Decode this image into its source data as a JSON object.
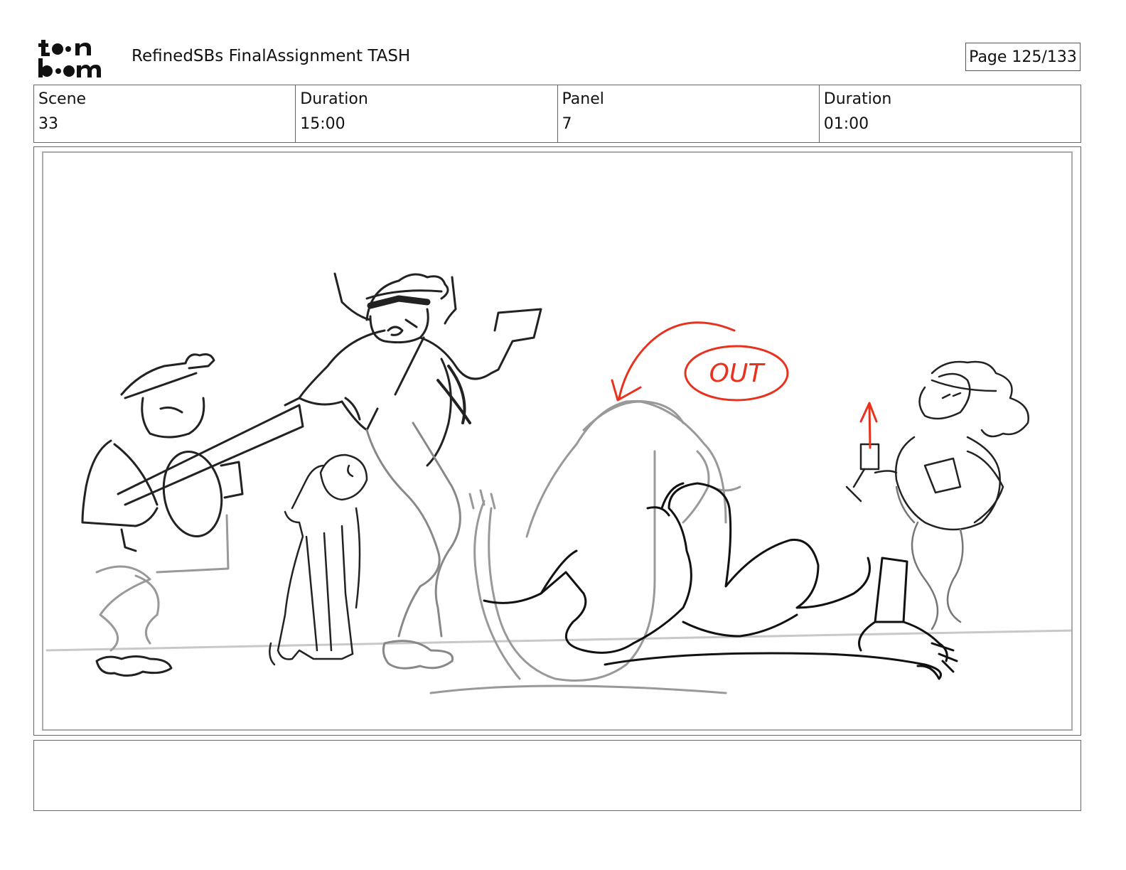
{
  "header": {
    "logo_text": "toon boom",
    "title": "RefinedSBs FinalAssignment TASH",
    "page_label": "Page 125/133"
  },
  "info": {
    "scene_label": "Scene",
    "scene_value": "33",
    "scene_duration_label": "Duration",
    "scene_duration_value": "15:00",
    "panel_label": "Panel",
    "panel_value": "7",
    "panel_duration_label": "Duration",
    "panel_duration_value": "01:00"
  },
  "panel": {
    "annotation": "OUT",
    "annotation_color": "#e8321e"
  },
  "notes": {
    "text": ""
  }
}
